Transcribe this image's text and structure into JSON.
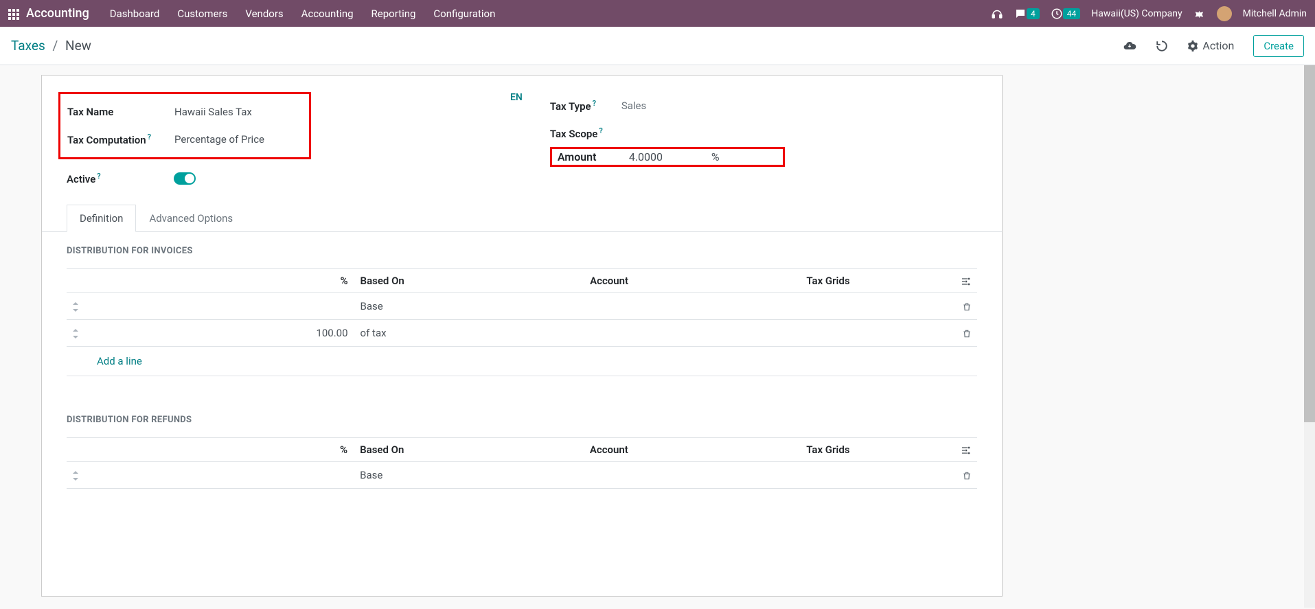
{
  "navbar": {
    "brand": "Accounting",
    "menu": [
      "Dashboard",
      "Customers",
      "Vendors",
      "Accounting",
      "Reporting",
      "Configuration"
    ],
    "chat_badge": "4",
    "activity_badge": "44",
    "company": "Hawaii(US) Company",
    "user": "Mitchell Admin"
  },
  "breadcrumb": {
    "root": "Taxes",
    "current": "New"
  },
  "controls": {
    "action": "Action",
    "create": "Create"
  },
  "form": {
    "tax_name_label": "Tax Name",
    "tax_name_value": "Hawaii Sales Tax",
    "tax_computation_label": "Tax Computation",
    "tax_computation_value": "Percentage of Price",
    "active_label": "Active",
    "lang": "EN",
    "tax_type_label": "Tax Type",
    "tax_type_value": "Sales",
    "tax_scope_label": "Tax Scope",
    "amount_label": "Amount",
    "amount_value": "4.0000",
    "amount_unit": "%"
  },
  "tabs": {
    "definition": "Definition",
    "advanced": "Advanced Options"
  },
  "invoices": {
    "title": "DISTRIBUTION FOR INVOICES",
    "cols": {
      "pct": "%",
      "based": "Based On",
      "account": "Account",
      "grids": "Tax Grids"
    },
    "rows": [
      {
        "pct": "",
        "based": "Base"
      },
      {
        "pct": "100.00",
        "based": "of tax"
      }
    ],
    "add": "Add a line"
  },
  "refunds": {
    "title": "DISTRIBUTION FOR REFUNDS",
    "cols": {
      "pct": "%",
      "based": "Based On",
      "account": "Account",
      "grids": "Tax Grids"
    },
    "rows": [
      {
        "pct": "",
        "based": "Base"
      }
    ]
  }
}
